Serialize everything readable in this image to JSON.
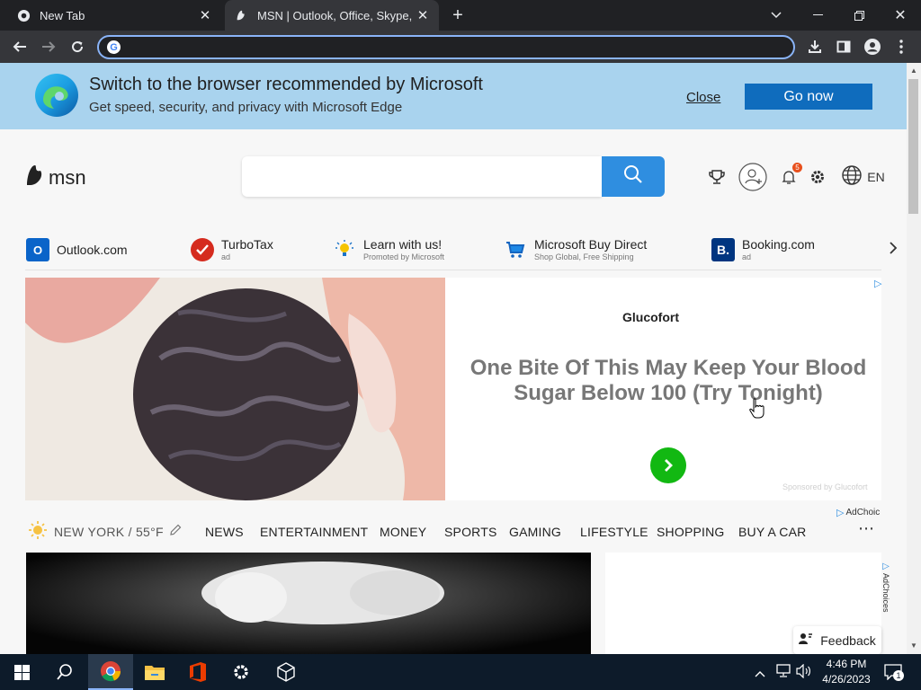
{
  "browser": {
    "tabs": [
      {
        "title": "New Tab",
        "icon": "chrome-icon"
      },
      {
        "title": "MSN | Outlook, Office, Skype, Bing",
        "icon": "msn-icon"
      }
    ],
    "address_value": ""
  },
  "banner": {
    "title": "Switch to the browser recommended by Microsoft",
    "subtitle": "Get speed, security, and privacy with Microsoft Edge",
    "close_label": "Close",
    "go_label": "Go now"
  },
  "header": {
    "logo_text": "msn",
    "search_placeholder": "",
    "notification_count": "5",
    "language": "EN"
  },
  "quick_links": [
    {
      "title": "Outlook.com",
      "sub": ""
    },
    {
      "title": "TurboTax",
      "sub": "ad"
    },
    {
      "title": "Learn with us!",
      "sub": "Promoted by Microsoft"
    },
    {
      "title": "Microsoft Buy Direct",
      "sub": "Shop Global, Free Shipping"
    },
    {
      "title": "Booking.com",
      "sub": "ad"
    }
  ],
  "ad": {
    "brand": "Glucofort",
    "headline": "One Bite Of This May Keep Your Blood Sugar Below 100 (Try Tonight)",
    "sponsored": "Sponsored by Glucofort",
    "adchoices": "AdChoic"
  },
  "weather": {
    "location": "NEW YORK / 55°F"
  },
  "nav": [
    "NEWS",
    "ENTERTAINMENT",
    "MONEY",
    "SPORTS",
    "GAMING",
    "LIFESTYLE",
    "SHOPPING",
    "BUY A CAR"
  ],
  "side_adchoices": "AdChoices",
  "feedback_label": "Feedback",
  "taskbar": {
    "time": "4:46 PM",
    "date": "4/26/2023",
    "notification_count": "1"
  },
  "colors": {
    "accent": "#2f8ee0",
    "banner": "#a9d3ee",
    "go_button": "#0f6cbd"
  }
}
